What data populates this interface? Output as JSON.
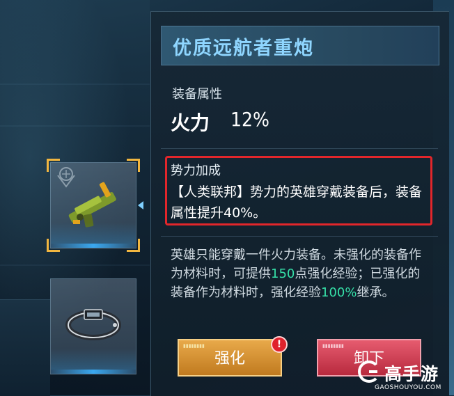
{
  "equipment": {
    "title": "优质远航者重炮",
    "attribute_section_label": "装备属性",
    "attribute_name": "火力",
    "attribute_value": "12%"
  },
  "faction_bonus": {
    "title": "势力加成",
    "description": "【人类联邦】势力的英雄穿戴装备后，装备属性提升40%。"
  },
  "description": {
    "part1": "英雄只能穿戴一件火力装备。未强化的装备作为材料时，可提供",
    "exp_value": "150",
    "part2": "点强化经验；已强化的装备作为材料时，强化经验",
    "inherit_rate": "100%",
    "part3": "继承。"
  },
  "buttons": {
    "enhance_label": "强化",
    "unequip_label": "卸下",
    "alert_mark": "!"
  },
  "watermark": {
    "brand": "高手游",
    "domain": "GAOSHOUYOU.COM"
  },
  "colors": {
    "title": "#8fd6ff",
    "highlight": "#36e0a8",
    "faction_box_border": "#e2262b",
    "enhance_button": "#d8923a",
    "unequip_button": "#cf4257",
    "slot_corner": "#f1b640"
  },
  "icons": {
    "slot1_item": "cannon-weapon-icon",
    "slot2_item": "armband-gear-icon",
    "faction_emblem": "faction-emblem-icon"
  }
}
